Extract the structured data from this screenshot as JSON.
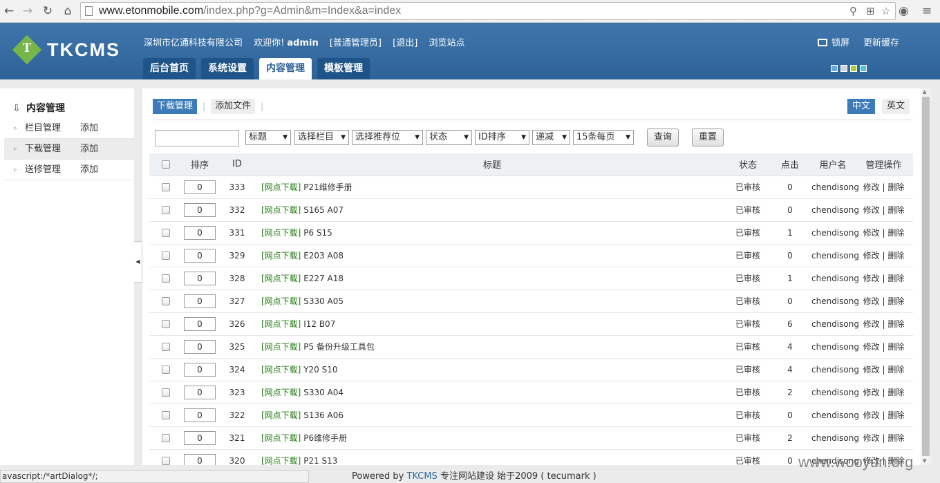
{
  "browser": {
    "url_host": "www.etonmobile.com",
    "url_path": "/index.php?g=Admin&m=Index&a=index"
  },
  "header": {
    "logo_text": "TKCMS",
    "logo_mark": "T",
    "company": "深圳市亿通科技有限公司",
    "welcome": "欢迎你!",
    "username": "admin",
    "role": "[普通管理员]",
    "logout": "[退出]",
    "browse": "浏览站点",
    "lock": "锁屏",
    "refresh_cache": "更新缓存",
    "tabs": [
      "后台首页",
      "系统设置",
      "内容管理",
      "模板管理"
    ],
    "active_tab": 2,
    "skin_colors": [
      "#6aa6d8",
      "#cfd6dd",
      "#a8cf3a",
      "#4fc3d9"
    ]
  },
  "sidebar": {
    "title": "内容管理",
    "items": [
      {
        "label": "栏目管理",
        "add": "添加"
      },
      {
        "label": "下载管理",
        "add": "添加"
      },
      {
        "label": "送修管理",
        "add": "添加"
      }
    ]
  },
  "main": {
    "subtabs": [
      "下载管理",
      "添加文件"
    ],
    "lang": [
      "中文",
      "英文"
    ],
    "filters": {
      "search_value": "",
      "selects": [
        "标题",
        "选择栏目",
        "选择推荐位",
        "状态",
        "ID排序",
        "递减",
        "15条每页"
      ],
      "query": "查询",
      "reset": "重置"
    },
    "columns": [
      "排序",
      "ID",
      "标题",
      "状态",
      "点击",
      "用户名",
      "管理操作"
    ],
    "edit_label": "修改",
    "delete_label": "删除",
    "rows": [
      {
        "order": "0",
        "id": "333",
        "cat": "[网点下载]",
        "title": "P21维修手册",
        "status": "已审核",
        "clicks": "0",
        "user": "chendisong"
      },
      {
        "order": "0",
        "id": "332",
        "cat": "[网点下载]",
        "title": "S165 A07",
        "status": "已审核",
        "clicks": "0",
        "user": "chendisong"
      },
      {
        "order": "0",
        "id": "331",
        "cat": "[网点下载]",
        "title": "P6 S15",
        "status": "已审核",
        "clicks": "1",
        "user": "chendisong"
      },
      {
        "order": "0",
        "id": "329",
        "cat": "[网点下载]",
        "title": "E203 A08",
        "status": "已审核",
        "clicks": "0",
        "user": "chendisong"
      },
      {
        "order": "0",
        "id": "328",
        "cat": "[网点下载]",
        "title": "E227 A18",
        "status": "已审核",
        "clicks": "1",
        "user": "chendisong"
      },
      {
        "order": "0",
        "id": "327",
        "cat": "[网点下载]",
        "title": "S330 A05",
        "status": "已审核",
        "clicks": "0",
        "user": "chendisong"
      },
      {
        "order": "0",
        "id": "326",
        "cat": "[网点下载]",
        "title": "I12 B07",
        "status": "已审核",
        "clicks": "6",
        "user": "chendisong"
      },
      {
        "order": "0",
        "id": "325",
        "cat": "[网点下载]",
        "title": "P5 备份升级工具包",
        "status": "已审核",
        "clicks": "4",
        "user": "chendisong"
      },
      {
        "order": "0",
        "id": "324",
        "cat": "[网点下载]",
        "title": "Y20 S10",
        "status": "已审核",
        "clicks": "4",
        "user": "chendisong"
      },
      {
        "order": "0",
        "id": "323",
        "cat": "[网点下载]",
        "title": "S330 A04",
        "status": "已审核",
        "clicks": "2",
        "user": "chendisong"
      },
      {
        "order": "0",
        "id": "322",
        "cat": "[网点下载]",
        "title": "S136 A06",
        "status": "已审核",
        "clicks": "0",
        "user": "chendisong"
      },
      {
        "order": "0",
        "id": "321",
        "cat": "[网点下载]",
        "title": "P6维修手册",
        "status": "已审核",
        "clicks": "2",
        "user": "chendisong"
      },
      {
        "order": "0",
        "id": "320",
        "cat": "[网点下载]",
        "title": "P21 S13",
        "status": "已审核",
        "clicks": "0",
        "user": "chendisong"
      }
    ]
  },
  "statusbar": "avascript:/*artDialog*/;",
  "footer": {
    "powered": "Powered by",
    "brand": "TKCMS",
    "slogan": "专注网站建设  始于2009 ( tecumark )"
  },
  "watermark": "www.wooyun.org"
}
